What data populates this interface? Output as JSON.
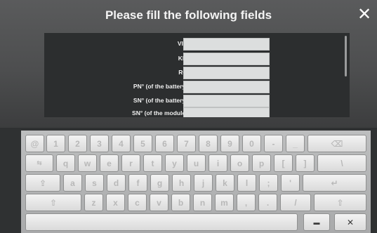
{
  "header": {
    "title": "Please fill the following fields",
    "close_glyph": "✕",
    "close_icon": "close-icon"
  },
  "form": {
    "fields": [
      {
        "label": "VIN",
        "value": ""
      },
      {
        "label": "KM",
        "value": ""
      },
      {
        "label": "RO",
        "value": ""
      },
      {
        "label": "PN° (of the battery)",
        "value": ""
      },
      {
        "label": "SN° (of the battery)",
        "value": ""
      },
      {
        "label": "SN° (of the module)",
        "value": ""
      }
    ]
  },
  "keyboard": {
    "rows": [
      [
        "@",
        "1",
        "2",
        "3",
        "4",
        "5",
        "6",
        "7",
        "8",
        "9",
        "0",
        "-",
        "_",
        "⌫"
      ],
      [
        "⇆",
        "q",
        "w",
        "e",
        "r",
        "t",
        "y",
        "u",
        "i",
        "o",
        "p",
        "[",
        "]",
        "\\"
      ],
      [
        "⇪",
        "a",
        "s",
        "d",
        "f",
        "g",
        "h",
        "j",
        "k",
        "l",
        ";",
        "'",
        "↵"
      ],
      [
        "⇧",
        "z",
        "x",
        "c",
        "v",
        "b",
        "n",
        "m",
        ",",
        ".",
        "/",
        "⇧"
      ],
      [
        " ",
        "▬",
        "✕"
      ]
    ],
    "hide_keyboard_icon": "keyboard-hide-icon",
    "close_keyboard_icon": "close-icon"
  },
  "colors": {
    "background": "#2f3132",
    "panel": "#2c2e2f",
    "field": "#dcdede",
    "keyboard": "#bdbebf"
  }
}
